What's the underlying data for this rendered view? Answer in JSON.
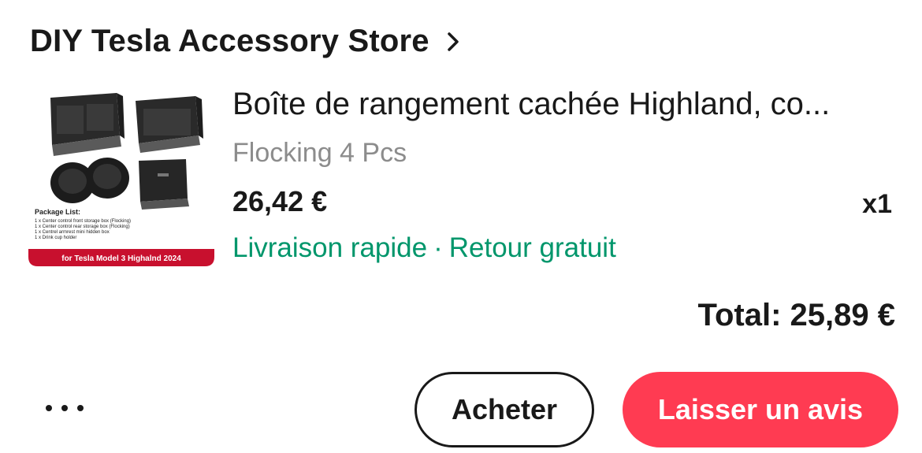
{
  "store": {
    "name": "DIY Tesla Accessory Store",
    "chevron_icon": "chevron-right-icon"
  },
  "product": {
    "title": "Boîte de rangement cachée Highland, co...",
    "variant": "Flocking 4 Pcs",
    "price": "26,42 €",
    "quantity": "x1",
    "shipping": {
      "fast_delivery": "Livraison rapide",
      "separator": "·",
      "free_returns": "Retour gratuit"
    },
    "image": {
      "package_list_title": "Package List:",
      "package_items": [
        "1 x Center control front storage box (Flocking)",
        "1 x Center control rear storage box (Flocking)",
        "1 x Centrel armrest mini hidden box",
        "1 x Drink cup holder"
      ],
      "banner": "for Tesla Model 3 Highalnd 2024"
    }
  },
  "order": {
    "total": "Total: 25,89 €"
  },
  "actions": {
    "more_icon": "more-horizontal-icon",
    "buy_label": "Acheter",
    "review_label": "Laisser un avis"
  },
  "colors": {
    "accent": "#ff3b52",
    "shipping_green": "#00966b",
    "muted_text": "#8c8c8c",
    "text": "#191919"
  }
}
